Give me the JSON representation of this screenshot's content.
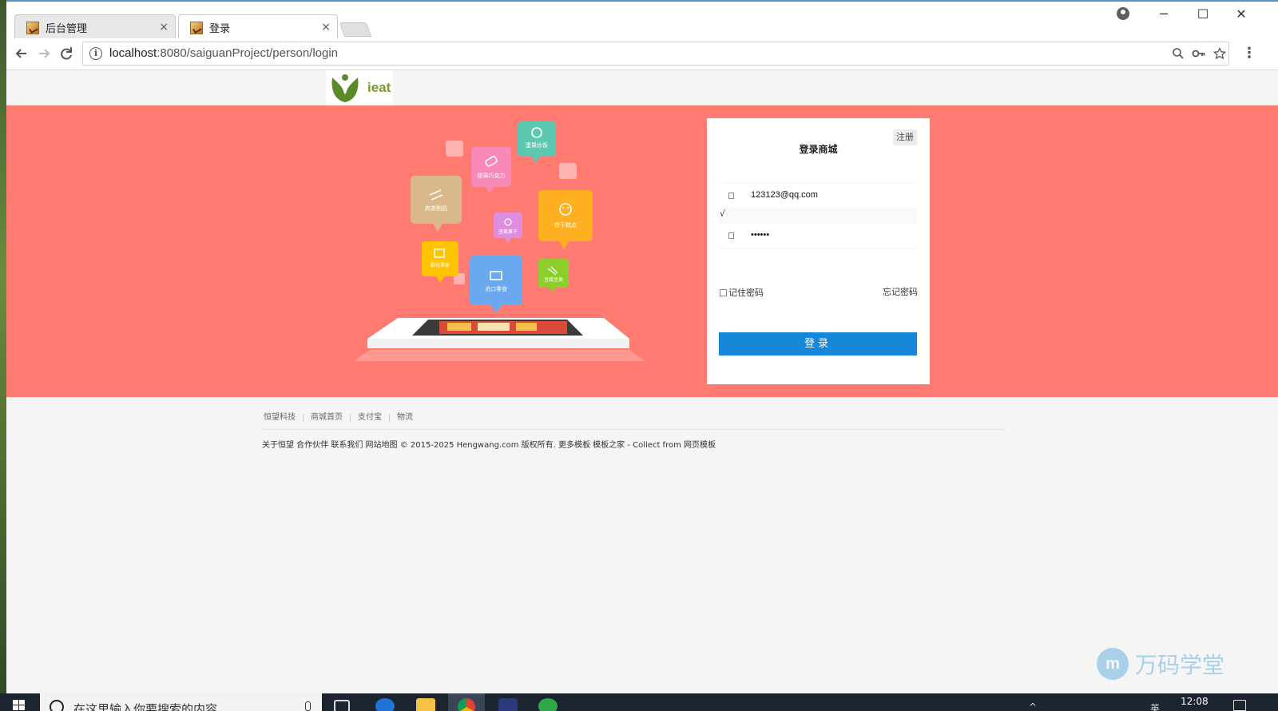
{
  "browser": {
    "tabs": [
      {
        "label": "后台管理",
        "active": false
      },
      {
        "label": "登录",
        "active": true
      }
    ],
    "tab_close_label": "×",
    "url_host": "localhost",
    "url_rest": ":8080/saiguanProject/person/login",
    "window_controls": {
      "minimize": "─",
      "maximize": "☐",
      "close": "✕"
    }
  },
  "header": {
    "logo_text": "ieat"
  },
  "illustration": {
    "bubbles": [
      "蛋果炒饭",
      "甜果巧克力",
      "肉类制品",
      "坚果果干",
      "饼干糕点",
      "膨化零食",
      "进口零食",
      "豆腐豆类"
    ]
  },
  "login": {
    "register_label": "注册",
    "title": "登录商城",
    "email_value": "123123@qq.com",
    "check_mark": "√",
    "password_value": "••••••",
    "remember_label": "记住密码",
    "forgot_label": "忘记密码",
    "submit_label": "登录"
  },
  "footer": {
    "links": [
      "恒望科技",
      "商城首页",
      "支付宝",
      "物流"
    ],
    "copyright": "关于恒望 合作伙伴 联系我们 网站地图 © 2015-2025 Hengwang.com 版权所有. 更多模板 模板之家 - Collect from 网页模板"
  },
  "watermark": {
    "badge": "m",
    "text": "万码学堂"
  },
  "taskbar": {
    "search_placeholder": "在这里输入你要搜索的内容",
    "clock": "12:08",
    "ime": "英"
  },
  "colors": {
    "banner": "#ff7a70",
    "login_button": "#1788d9",
    "logo_green": "#7a9a2a"
  }
}
